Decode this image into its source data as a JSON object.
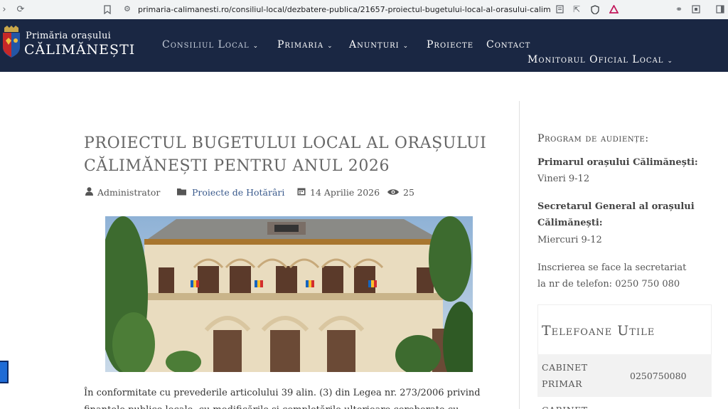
{
  "browser": {
    "url": "primaria-calimanesti.ro/consiliul-local/dezbatere-publica/21657-proiectul-bugetului-local-al-orasului-calimanesti-pentru-..."
  },
  "header": {
    "brand_line1": "Primăria orașului",
    "brand_line2": "CĂLIMĂNEȘTI",
    "nav": [
      {
        "label": "Consiliul Local"
      },
      {
        "label": "Primaria"
      },
      {
        "label": "Anunțuri"
      },
      {
        "label": "Proiecte"
      },
      {
        "label": "Contact"
      },
      {
        "label": "Monitorul Oficial Local"
      }
    ]
  },
  "article": {
    "title": "PROIECTUL BUGETULUI LOCAL AL ORAȘULUI CĂLIMĂNEȘTI PENTRU ANUL 2026",
    "author": "Administrator",
    "category": "Proiecte de Hotărâri",
    "date": "14 Aprilie 2026",
    "views": "25",
    "paragraph": "În conformitate cu prevederile articolului 39 alin. (3) din Legea nr. 273/2006 privind finanțele publice locale, cu modificările și completările ulterioare coroborate cu"
  },
  "sidebar": {
    "heading": "Program de audiențe:",
    "primar_label": "Primarul orașului Călimănești:",
    "primar_time": "Vineri 9-12",
    "secretar_label_1": "Secretarul General al orașului",
    "secretar_label_2": "Călimănești:",
    "secretar_time": "Miercuri 9-12",
    "inscriere_1": "Inscrierea se face la secretariat",
    "inscriere_2": "la nr de telefon: 0250 750 080",
    "tel_title": "Telefoane Utile",
    "tel_rows": [
      {
        "name_1": "CABINET",
        "name_2": "PRIMAR",
        "phone": "0250750080"
      },
      {
        "name_1": "CABINET",
        "name_2": "",
        "phone": ""
      }
    ]
  },
  "colors": {
    "header_bg": "#1a2743",
    "link": "#3a5a8c"
  }
}
